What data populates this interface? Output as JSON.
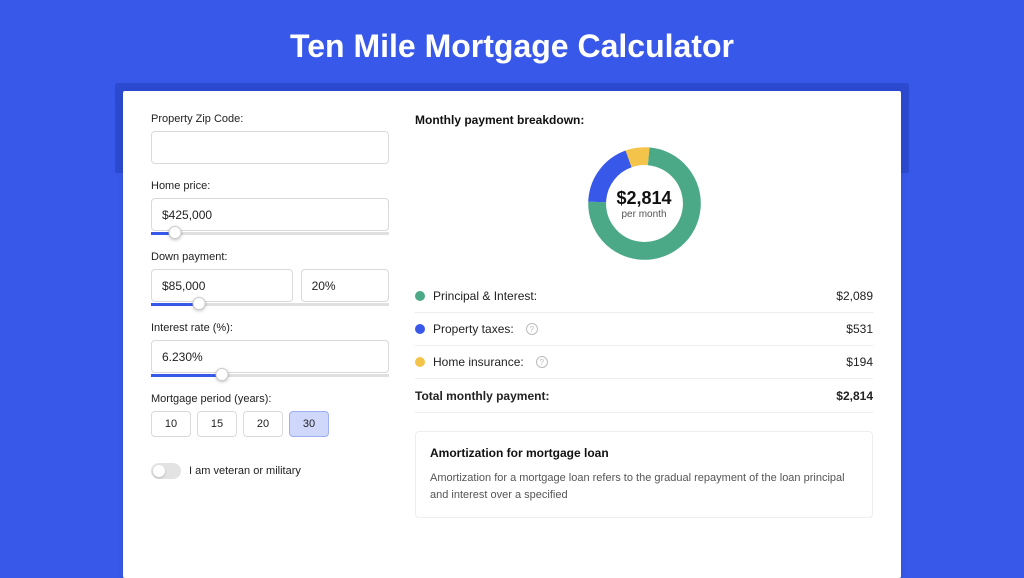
{
  "hero": {
    "title": "Ten Mile Mortgage Calculator"
  },
  "colors": {
    "principal": "#4CA988",
    "taxes": "#3858E9",
    "insurance": "#F3C449"
  },
  "form": {
    "zip": {
      "label": "Property Zip Code:",
      "value": ""
    },
    "price": {
      "label": "Home price:",
      "value": "$425,000",
      "slider_pct": 10
    },
    "down": {
      "label": "Down payment:",
      "amount": "$85,000",
      "pct": "20%",
      "slider_pct": 20
    },
    "rate": {
      "label": "Interest rate (%):",
      "value": "6.230%",
      "slider_pct": 30
    },
    "period": {
      "label": "Mortgage period (years):",
      "options": [
        "10",
        "15",
        "20",
        "30"
      ],
      "active": "30"
    },
    "vet": {
      "label": "I am veteran or military"
    }
  },
  "breakdown": {
    "title": "Monthly payment breakdown:",
    "center_amount": "$2,814",
    "center_sub": "per month",
    "rows": [
      {
        "key": "principal",
        "label": "Principal & Interest:",
        "value": "$2,089",
        "info": false
      },
      {
        "key": "taxes",
        "label": "Property taxes:",
        "value": "$531",
        "info": true
      },
      {
        "key": "insurance",
        "label": "Home insurance:",
        "value": "$194",
        "info": true
      }
    ],
    "total_label": "Total monthly payment:",
    "total_value": "$2,814"
  },
  "amort": {
    "title": "Amortization for mortgage loan",
    "text": "Amortization for a mortgage loan refers to the gradual repayment of the loan principal and interest over a specified"
  },
  "chart_data": {
    "type": "pie",
    "title": "Monthly payment breakdown",
    "categories": [
      "Principal & Interest",
      "Property taxes",
      "Home insurance"
    ],
    "values": [
      2089,
      531,
      194
    ],
    "total": 2814,
    "unit": "USD/month"
  }
}
